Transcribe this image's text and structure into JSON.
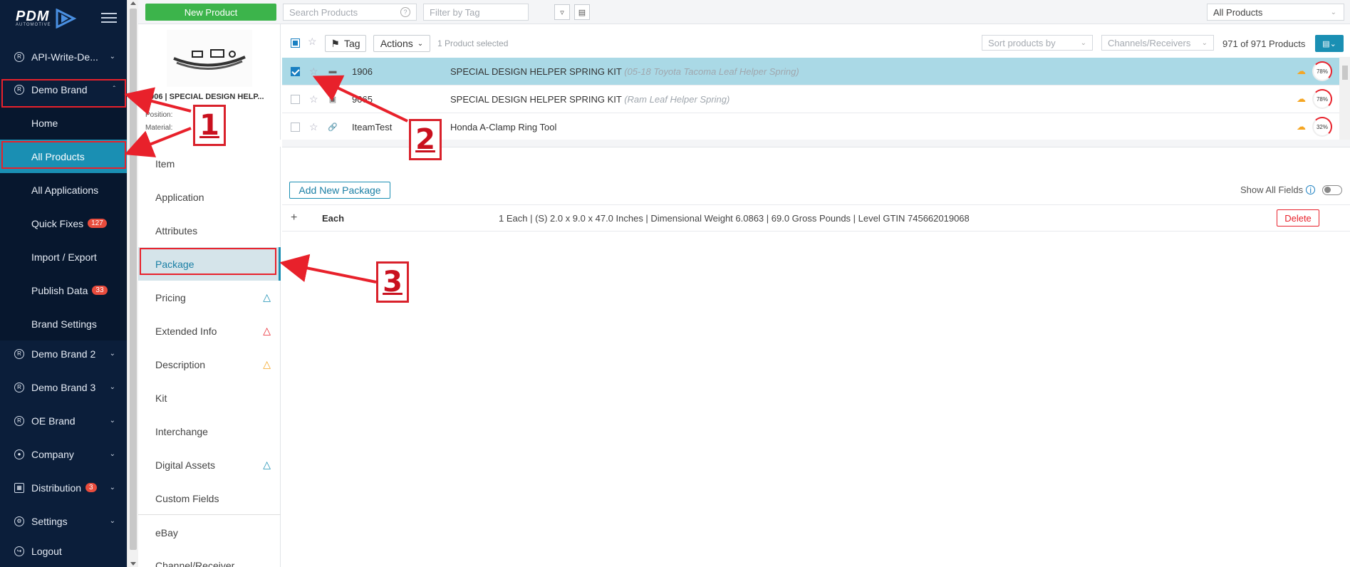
{
  "sidebar": {
    "logo_text": "PDM",
    "logo_sub": "AUTOMOTIVE",
    "items": [
      {
        "label": "API-Write-De..."
      },
      {
        "label": "Demo Brand"
      },
      {
        "label": "Demo Brand 2"
      },
      {
        "label": "Demo Brand 3"
      },
      {
        "label": "OE Brand"
      },
      {
        "label": "Company"
      },
      {
        "label": "Distribution",
        "badge": "3"
      },
      {
        "label": "Settings"
      },
      {
        "label": "Logout"
      }
    ],
    "sub_items": [
      {
        "label": "Home"
      },
      {
        "label": "All Products"
      },
      {
        "label": "All Applications"
      },
      {
        "label": "Quick Fixes",
        "badge": "127"
      },
      {
        "label": "Import / Export"
      },
      {
        "label": "Publish Data",
        "badge": "33"
      },
      {
        "label": "Brand Settings"
      }
    ]
  },
  "topbar": {
    "new_product": "New Product",
    "search_placeholder": "Search Products",
    "tag_placeholder": "Filter by Tag",
    "all_products": "All Products"
  },
  "product_panel": {
    "title": "1906 | SPECIAL DESIGN HELP...",
    "position_label": "Position:",
    "material_label": "Material:"
  },
  "list_toolbar": {
    "tag_label": "Tag",
    "actions_label": "Actions",
    "selected_text": "1 Product selected",
    "sort_placeholder": "Sort products by",
    "channels_placeholder": "Channels/Receivers",
    "count_text": "971 of 971 Products"
  },
  "products": [
    {
      "number": "1906",
      "desc": "SPECIAL DESIGN HELPER SPRING KIT",
      "sub": "(05-18 Toyota Tacoma Leaf Helper Spring)",
      "pct": "78%",
      "selected": true
    },
    {
      "number": "9065",
      "desc": "SPECIAL DESIGN HELPER SPRING KIT",
      "sub": "(Ram Leaf Helper Spring)",
      "pct": "78%",
      "selected": false
    },
    {
      "number": "IteamTest",
      "desc": "Honda A-Clamp Ring Tool",
      "sub": "",
      "pct": "32%",
      "selected": false
    }
  ],
  "tabs": [
    {
      "label": "Item"
    },
    {
      "label": "Application"
    },
    {
      "label": "Attributes"
    },
    {
      "label": "Package"
    },
    {
      "label": "Pricing"
    },
    {
      "label": "Extended Info"
    },
    {
      "label": "Description"
    },
    {
      "label": "Kit"
    },
    {
      "label": "Interchange"
    },
    {
      "label": "Digital Assets"
    },
    {
      "label": "Custom Fields"
    },
    {
      "label": "eBay"
    },
    {
      "label": "Channel/Receiver"
    }
  ],
  "package": {
    "add_button": "Add New Package",
    "show_all_fields": "Show All Fields",
    "row_name": "Each",
    "row_detail": "1 Each | (S) 2.0 x 9.0 x 47.0 Inches | Dimensional Weight 6.0863 | 69.0 Gross Pounds | Level GTIN 745662019068",
    "delete_label": "Delete"
  },
  "annotations": [
    "1",
    "2",
    "3"
  ],
  "colors": {
    "sidebar_bg": "#0b1e3a",
    "accent": "#1a8fb3",
    "new_button": "#3cb44b",
    "annotation_red": "#e8212b"
  }
}
